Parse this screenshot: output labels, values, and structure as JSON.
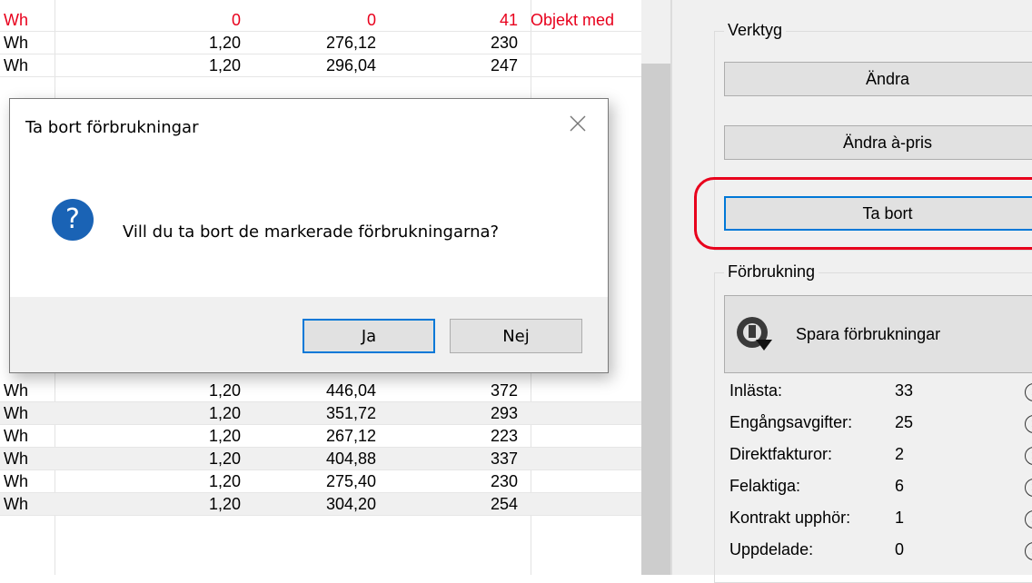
{
  "grid": {
    "rows": [
      {
        "unit": "Wh",
        "price": "0",
        "amount": "0",
        "qty": "41",
        "note": "Objekt med",
        "red": true
      },
      {
        "unit": "Wh",
        "price": "1,20",
        "amount": "276,12",
        "qty": "230",
        "note": ""
      },
      {
        "unit": "Wh",
        "price": "1,20",
        "amount": "296,04",
        "qty": "247",
        "note": ""
      },
      {
        "unit": "Wh",
        "price": "1,20",
        "amount": "446,04",
        "qty": "372",
        "note": ""
      },
      {
        "unit": "Wh",
        "price": "1,20",
        "amount": "351,72",
        "qty": "293",
        "note": ""
      },
      {
        "unit": "Wh",
        "price": "1,20",
        "amount": "267,12",
        "qty": "223",
        "note": ""
      },
      {
        "unit": "Wh",
        "price": "1,20",
        "amount": "404,88",
        "qty": "337",
        "note": ""
      },
      {
        "unit": "Wh",
        "price": "1,20",
        "amount": "275,40",
        "qty": "230",
        "note": ""
      },
      {
        "unit": "Wh",
        "price": "1,20",
        "amount": "304,20",
        "qty": "254",
        "note": ""
      }
    ]
  },
  "tools": {
    "legend": "Verktyg",
    "edit_label": "Ändra",
    "edit_price_label": "Ändra à-pris",
    "delete_label": "Ta bort"
  },
  "consumption": {
    "legend": "Förbrukning",
    "save_label": "Spara förbrukningar",
    "stats": [
      {
        "label": "Inlästa:",
        "value": "33"
      },
      {
        "label": "Engångsavgifter:",
        "value": "25"
      },
      {
        "label": "Direktfakturor:",
        "value": "2"
      },
      {
        "label": "Felaktiga:",
        "value": "6"
      },
      {
        "label": "Kontrakt upphör:",
        "value": "1"
      },
      {
        "label": "Uppdelade:",
        "value": "0"
      }
    ],
    "info_icon": "info-icon"
  },
  "dialog": {
    "title": "Ta bort förbrukningar",
    "message": "Vill du ta bort de markerade förbrukningarna?",
    "question_mark": "?",
    "yes_label": "Ja",
    "no_label": "Nej"
  },
  "colors": {
    "warning_text": "#e8001c",
    "question_icon": "#1a63b5",
    "focus_border": "#0078d7",
    "highlight": "#e8001c"
  }
}
